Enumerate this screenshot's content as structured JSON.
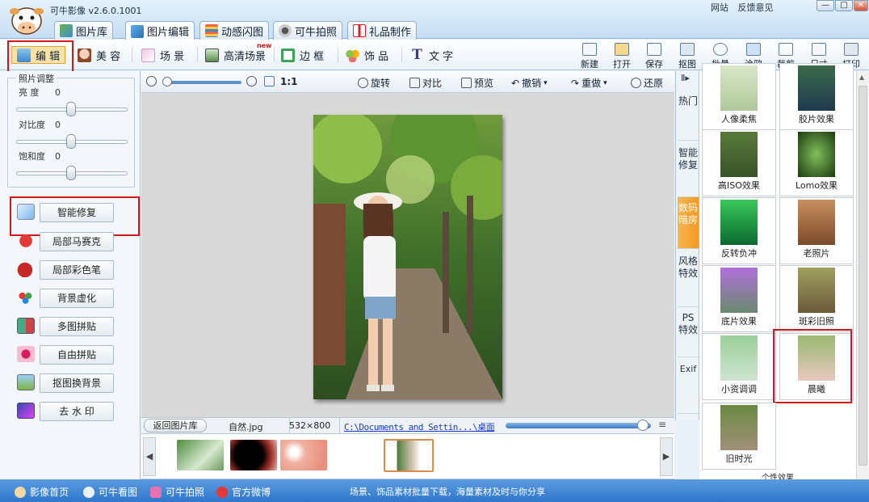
{
  "app": {
    "title": "可牛影像 v2.6.0.1001",
    "website": "网站",
    "feedback": "反馈意见",
    "min": "—",
    "max": "□",
    "close": "✕"
  },
  "main_tabs": [
    "图片库",
    "图片编辑",
    "动感闪图",
    "可牛拍照",
    "礼品制作"
  ],
  "tools_left": [
    {
      "label": "编 辑",
      "icon": "edit-icon"
    },
    {
      "label": "美 容",
      "icon": "face-icon"
    },
    {
      "label": "场 景",
      "icon": "scene-icon"
    },
    {
      "label": "高清场景",
      "icon": "hd-scene-icon",
      "badge": "new"
    },
    {
      "label": "边 框",
      "icon": "frame-icon"
    },
    {
      "label": "饰 品",
      "icon": "decoration-icon"
    },
    {
      "label": "文 字",
      "icon": "text-icon"
    }
  ],
  "tools_right": [
    "新建",
    "打开",
    "保存",
    "抠图",
    "批量",
    "涂鸦",
    "裁剪",
    "尺寸",
    "打印"
  ],
  "adjust": {
    "title": "照片调整",
    "brightness_label": "亮  度",
    "contrast_label": "对比度",
    "saturation_label": "饱和度",
    "brightness": "0",
    "contrast": "0",
    "saturation": "0"
  },
  "left_buttons": [
    "智能修复",
    "局部马赛克",
    "局部彩色笔",
    "背景虚化",
    "多图拼贴",
    "自由拼贴",
    "抠图换背景",
    "去 水 印"
  ],
  "canvas_toolbar": {
    "zoom_ratio": "1:1",
    "rotate": "旋转",
    "compare": "对比",
    "preview": "预览",
    "undo": "撤销",
    "redo": "重做",
    "restore": "还原"
  },
  "info": {
    "back": "返回图片库",
    "filename": "自然.jpg",
    "size": "532×800",
    "path": "C:\\Documents and Settin...\\桌面"
  },
  "side_tabs": [
    "热门",
    "智能修复",
    "数码暗房",
    "风格特效",
    "PS特效",
    "Exif"
  ],
  "effects": [
    "人像柔焦",
    "胶片效果",
    "高ISO效果",
    "Lomo效果",
    "反转负冲",
    "老照片",
    "底片效果",
    "斑彩旧照",
    "小资调调",
    "晨曦",
    "旧时光"
  ],
  "effects_more": "个性效果",
  "statusbar": {
    "home": "影像首页",
    "viewer": "可牛看图",
    "camera": "可牛拍照",
    "weibo": "官方微博",
    "promo": "场景、饰品素材批量下载，海量素材及时与你分享"
  },
  "colors": {
    "accent": "#f29a20",
    "highlight_red": "#d01818",
    "status_blue": "#2f77cc"
  }
}
